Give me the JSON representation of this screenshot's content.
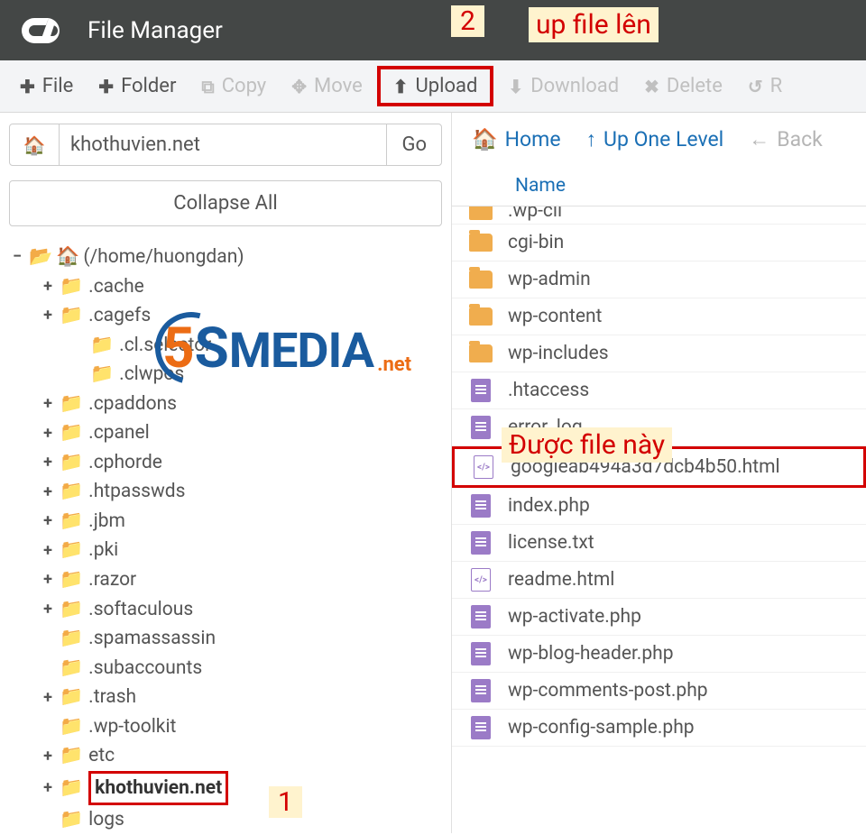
{
  "header": {
    "title": "File Manager"
  },
  "toolbar": {
    "file": "File",
    "folder": "Folder",
    "copy": "Copy",
    "move": "Move",
    "upload": "Upload",
    "download": "Download",
    "delete": "Delete",
    "restore": "R"
  },
  "left": {
    "address": "khothuvien.net",
    "go": "Go",
    "collapse": "Collapse All",
    "root": "(/home/huongdan)",
    "nodes": [
      {
        "level": 1,
        "exp": "+",
        "open": false,
        "label": ".cache"
      },
      {
        "level": 1,
        "exp": "+",
        "open": false,
        "label": ".cagefs"
      },
      {
        "level": 2,
        "exp": "",
        "open": false,
        "label": ".cl.selector"
      },
      {
        "level": 2,
        "exp": "",
        "open": false,
        "label": ".clwpos"
      },
      {
        "level": 1,
        "exp": "+",
        "open": false,
        "label": ".cpaddons"
      },
      {
        "level": 1,
        "exp": "+",
        "open": false,
        "label": ".cpanel"
      },
      {
        "level": 1,
        "exp": "+",
        "open": false,
        "label": ".cphorde"
      },
      {
        "level": 1,
        "exp": "+",
        "open": false,
        "label": ".htpasswds"
      },
      {
        "level": 1,
        "exp": "+",
        "open": false,
        "label": ".jbm"
      },
      {
        "level": 1,
        "exp": "+",
        "open": false,
        "label": ".pki"
      },
      {
        "level": 1,
        "exp": "+",
        "open": false,
        "label": ".razor"
      },
      {
        "level": 1,
        "exp": "+",
        "open": false,
        "label": ".softaculous"
      },
      {
        "level": 1,
        "exp": "",
        "open": false,
        "label": ".spamassassin"
      },
      {
        "level": 1,
        "exp": "",
        "open": false,
        "label": ".subaccounts"
      },
      {
        "level": 1,
        "exp": "+",
        "open": false,
        "label": ".trash"
      },
      {
        "level": 1,
        "exp": "",
        "open": false,
        "label": ".wp-toolkit"
      },
      {
        "level": 1,
        "exp": "+",
        "open": false,
        "label": "etc"
      },
      {
        "level": 1,
        "exp": "+",
        "open": false,
        "label": "khothuvien.net",
        "selected": true
      },
      {
        "level": 1,
        "exp": "",
        "open": false,
        "label": "logs"
      }
    ]
  },
  "right": {
    "nav": {
      "home": "Home",
      "up": "Up One Level",
      "back": "Back"
    },
    "col": "Name",
    "rows": [
      {
        "type": "folder",
        "label": ".wp-cli",
        "cut": true
      },
      {
        "type": "folder",
        "label": "cgi-bin"
      },
      {
        "type": "folder",
        "label": "wp-admin"
      },
      {
        "type": "folder",
        "label": "wp-content"
      },
      {
        "type": "folder",
        "label": "wp-includes"
      },
      {
        "type": "doc",
        "label": ".htaccess"
      },
      {
        "type": "doc",
        "label": "error_log"
      },
      {
        "type": "html",
        "label": "googleab494a3d7dcb4b50.html",
        "highlight": true
      },
      {
        "type": "doc",
        "label": "index.php"
      },
      {
        "type": "doc",
        "label": "license.txt"
      },
      {
        "type": "html",
        "label": "readme.html"
      },
      {
        "type": "doc",
        "label": "wp-activate.php"
      },
      {
        "type": "doc",
        "label": "wp-blog-header.php"
      },
      {
        "type": "doc",
        "label": "wp-comments-post.php"
      },
      {
        "type": "doc",
        "label": "wp-config-sample.php"
      }
    ]
  },
  "annotations": {
    "num1": "1",
    "num2": "2",
    "up_text": "up file lên",
    "got_file": "Được file này"
  }
}
